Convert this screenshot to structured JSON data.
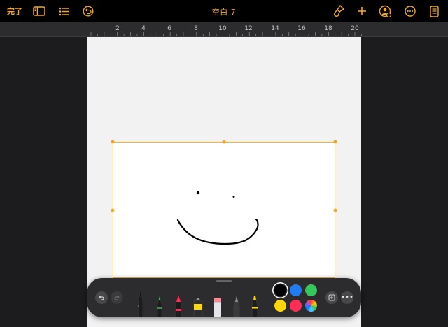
{
  "toolbar": {
    "done_label": "完了",
    "title": "空白 7",
    "accent_color": "#f5a623",
    "icons": [
      "sidebar-icon",
      "list-icon",
      "undo-icon",
      "format-brush-icon",
      "plus-icon",
      "collaborate-icon",
      "more-icon",
      "document-icon"
    ]
  },
  "ruler": {
    "labels": [
      "2",
      "4",
      "6",
      "8",
      "10",
      "12",
      "14",
      "16",
      "18",
      "20"
    ]
  },
  "palette": {
    "tools": [
      "pen",
      "pencil",
      "marker",
      "crayon",
      "highlighter",
      "eraser",
      "fountain-pen",
      "brush"
    ],
    "colors": {
      "black": "#000000",
      "blue": "#1f7cf2",
      "green": "#34c759",
      "yellow": "#ffd60a",
      "red": "#ff2d55"
    },
    "selected_color": "black",
    "more_label": "•••"
  }
}
